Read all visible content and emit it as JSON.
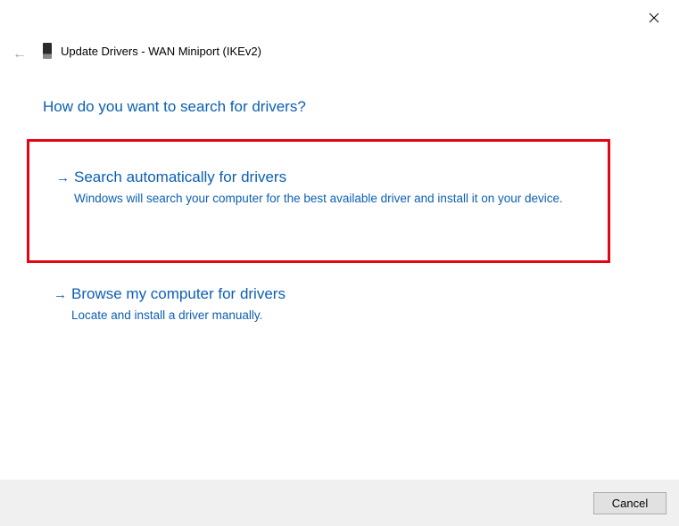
{
  "window": {
    "title": "Update Drivers - WAN Miniport (IKEv2)"
  },
  "heading": "How do you want to search for drivers?",
  "options": [
    {
      "title": "Search automatically for drivers",
      "description": "Windows will search your computer for the best available driver and install it on your device."
    },
    {
      "title": "Browse my computer for drivers",
      "description": "Locate and install a driver manually."
    }
  ],
  "footer": {
    "cancel_label": "Cancel"
  }
}
